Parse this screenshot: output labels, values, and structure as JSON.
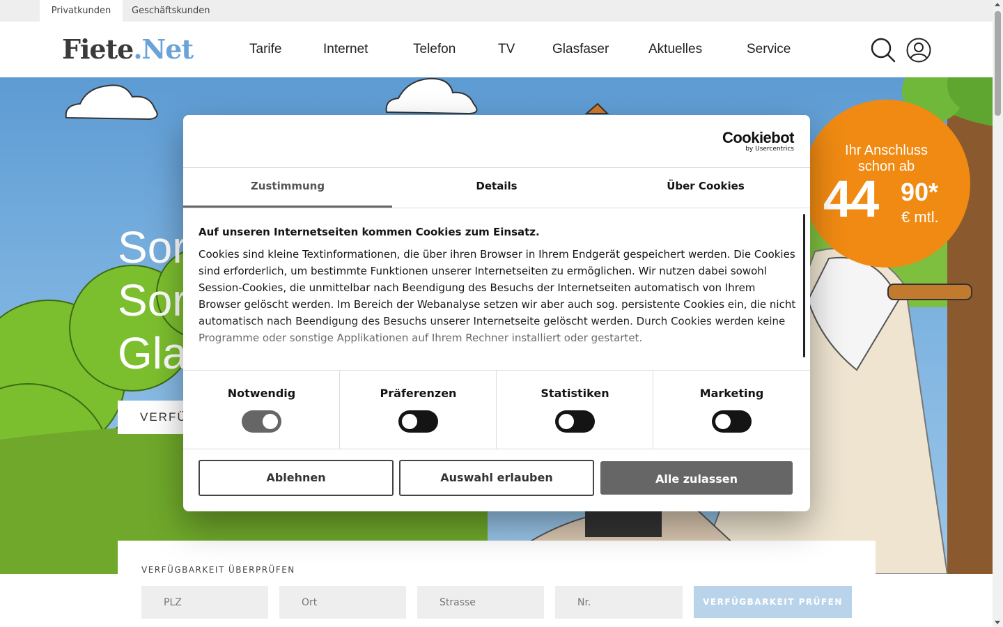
{
  "topbar": {
    "private": "Privatkunden",
    "business": "Geschäftskunden"
  },
  "header": {
    "logo_part1": "Fiete",
    "logo_part2": ".Net",
    "nav": [
      "Tarife",
      "Internet",
      "Telefon",
      "TV",
      "Glasfaser",
      "Aktuelles",
      "Service"
    ]
  },
  "hero": {
    "line1": "Sor",
    "line2": "Sor",
    "line3": "Gla",
    "button_partial": "VERFÜ"
  },
  "badge": {
    "line1": "Ihr Anschluss",
    "line2": "schon ab",
    "euros": "44",
    "cents": "90*",
    "unit": "€ mtl."
  },
  "availability": {
    "title": "VERFÜGBARKEIT ÜBERPRÜFEN",
    "plz_placeholder": "PLZ",
    "ort_placeholder": "Ort",
    "strasse_placeholder": "Strasse",
    "nr_placeholder": "Nr.",
    "button": "VERFÜGBARKEIT PRÜFEN"
  },
  "cookie": {
    "brand": "Cookiebot",
    "brand_sub": "by Usercentrics",
    "tabs": [
      "Zustimmung",
      "Details",
      "Über Cookies"
    ],
    "heading": "Auf unseren Internetseiten kommen Cookies zum Einsatz.",
    "text": "Cookies sind kleine Textinformationen, die über ihren Browser in Ihrem Endgerät gespeichert werden. Die Cookies sind erforderlich, um bestimmte Funktionen unserer Internetseiten zu ermöglichen. Wir nutzen dabei sowohl Session-Cookies, die unmittelbar nach Beendigung des Besuchs der Internetseiten automatisch von Ihrem Browser gelöscht werden. Im Bereich der Webanalyse setzen wir aber auch sog. persistente Cookies ein, die nicht automatisch nach Beendigung des Besuchs unserer Internetseite gelöscht werden. Durch Cookies werden keine Programme oder sonstige Applikationen auf Ihrem Rechner installiert oder gestartet.",
    "categories": [
      {
        "label": "Notwendig",
        "enabled": true
      },
      {
        "label": "Präferenzen",
        "enabled": false
      },
      {
        "label": "Statistiken",
        "enabled": false
      },
      {
        "label": "Marketing",
        "enabled": false
      }
    ],
    "buttons": {
      "decline": "Ablehnen",
      "allow_selection": "Auswahl erlauben",
      "allow_all": "Alle zulassen"
    }
  },
  "colors": {
    "accent_orange": "#f08a12",
    "logo_blue": "#6aa3d8",
    "button_grey": "#666666",
    "avail_button": "#b9d4ea"
  }
}
